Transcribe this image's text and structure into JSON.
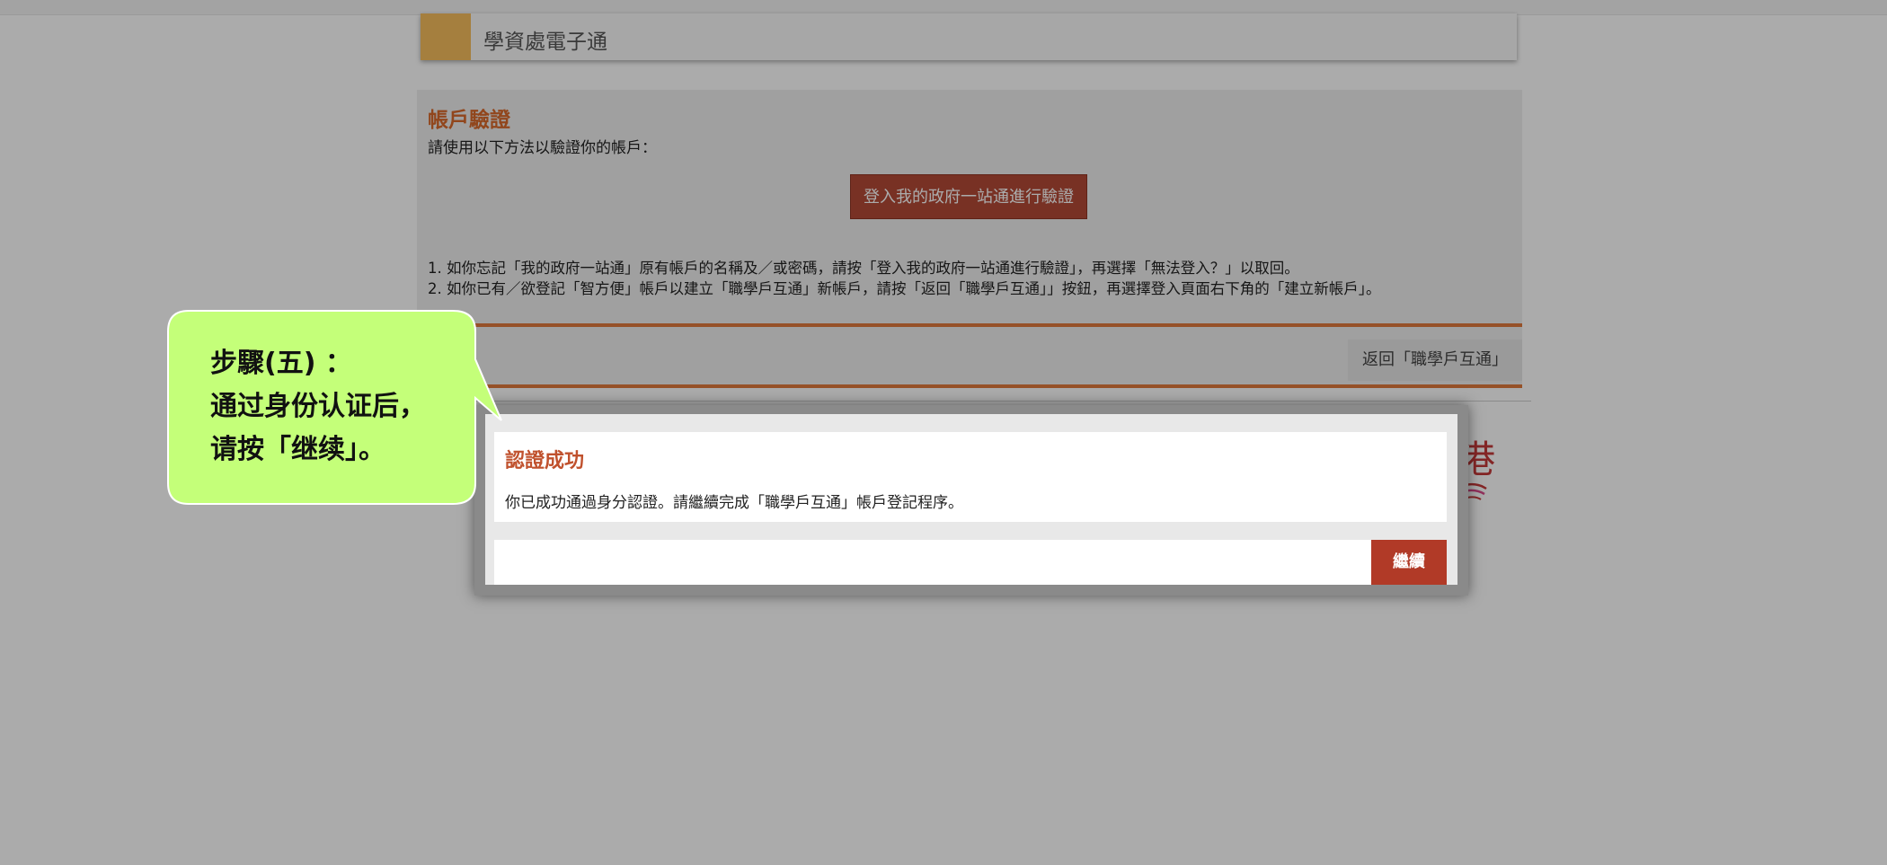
{
  "header": {
    "title": "學資處電子通"
  },
  "panel": {
    "title": "帳戶驗證",
    "intro": "請使用以下方法以驗證你的帳戶：",
    "login_button": "登入我的政府一站通進行驗證",
    "note1": "1. 如你忘記「我的政府一站通」原有帳戶的名稱及／或密碼，請按「登入我的政府一站通進行驗證」，再選擇「無法登入？」以取回。",
    "note2": "2. 如你已有／欲登記「智方便」帳戶以建立「職學戶互通」新帳戶，請按「返回「職學戶互通」」按鈕，再選擇登入頁面右下角的「建立新帳戶」。",
    "back_button": "返回「職學戶互通」"
  },
  "logo_fragment": "港",
  "modal": {
    "title": "認證成功",
    "message": "你已成功通過身分認證。請繼續完成「職學戶互通」帳戶登記程序。",
    "continue_button": "繼續"
  },
  "callout": {
    "line1": "步驟(五) ：",
    "line2": "通过身份认证后，",
    "line3": "请按「继续」。"
  },
  "colors": {
    "header_accent": "#f7be5d",
    "panel_title": "#d9692b",
    "primary_button": "#b34a37",
    "continue_button": "#b13a27",
    "callout_fill": "#c4ff79"
  }
}
